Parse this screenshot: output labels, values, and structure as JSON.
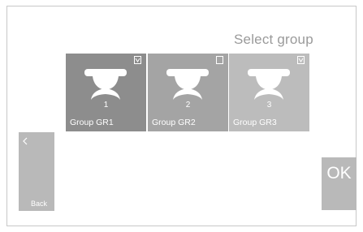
{
  "screen": {
    "title": "Select group"
  },
  "groups": [
    {
      "number": "1",
      "name": "Group GR1",
      "color": "#8d8d8d"
    },
    {
      "number": "2",
      "name": "Group GR2",
      "color": "#a4a4a4"
    },
    {
      "number": "3",
      "name": "Group GR3",
      "color": "#bcbcbc"
    }
  ],
  "buttons": {
    "back": "Back",
    "ok": "OK"
  },
  "icons": {
    "group": "ceiling-detector-icon",
    "select": "checkbox-icon",
    "back": "chevron-left-icon"
  }
}
